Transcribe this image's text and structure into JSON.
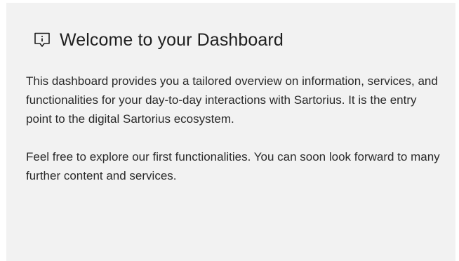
{
  "welcome_card": {
    "icon": "info-speech-bubble-icon",
    "title": "Welcome to your Dashboard",
    "paragraph_1": "This dashboard provides you a tailored overview on information, services, and functionalities for your day-to-day interactions with Sartorius. It is the entry point to the digital Sartorius ecosystem.",
    "paragraph_2": "Feel free to explore our first functionalities. You can soon look forward to many further content and services."
  }
}
